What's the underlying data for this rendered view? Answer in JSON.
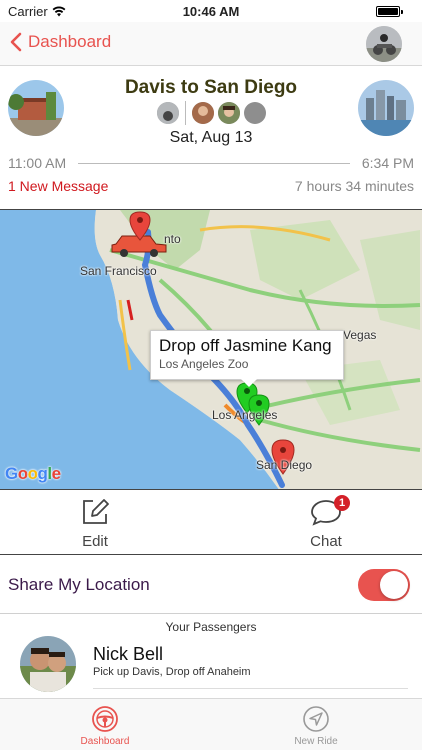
{
  "status_bar": {
    "carrier": "Carrier",
    "time": "10:46 AM",
    "battery_level": 1.0
  },
  "nav": {
    "back_label": "Dashboard"
  },
  "trip": {
    "title": "Davis to San Diego",
    "date": "Sat, Aug 13",
    "start_time": "11:00 AM",
    "end_time": "6:34 PM",
    "message_text": "1 New Message",
    "duration": "7 hours 34 minutes"
  },
  "map": {
    "labels": {
      "san_francisco": "San Francisco",
      "sacramento": "nto",
      "las_vegas": "Vegas",
      "los_angeles": "Los Angeles",
      "san_diego": "San Diego"
    },
    "callout": {
      "title": "Drop off Jasmine Kang",
      "subtitle": "Los Angeles Zoo"
    },
    "attribution": "Google",
    "pin_colors": {
      "origin": "#e8453c",
      "pickup": "#22cc22",
      "destination": "#e8453c"
    }
  },
  "actions": {
    "edit_label": "Edit",
    "chat_label": "Chat",
    "chat_badge": "1"
  },
  "share": {
    "label": "Share My Location",
    "enabled": true
  },
  "passengers": {
    "header": "Your Passengers",
    "items": [
      {
        "name": "Nick Bell",
        "detail": "Pick up Davis, Drop off Anaheim"
      }
    ]
  },
  "tabs": [
    {
      "label": "Dashboard",
      "active": true,
      "icon": "steering-wheel-icon"
    },
    {
      "label": "New Ride",
      "active": false,
      "icon": "navigation-arrow-icon"
    }
  ],
  "colors": {
    "accent": "#e8534f",
    "title": "#3d3b12",
    "message": "#d0191f"
  }
}
